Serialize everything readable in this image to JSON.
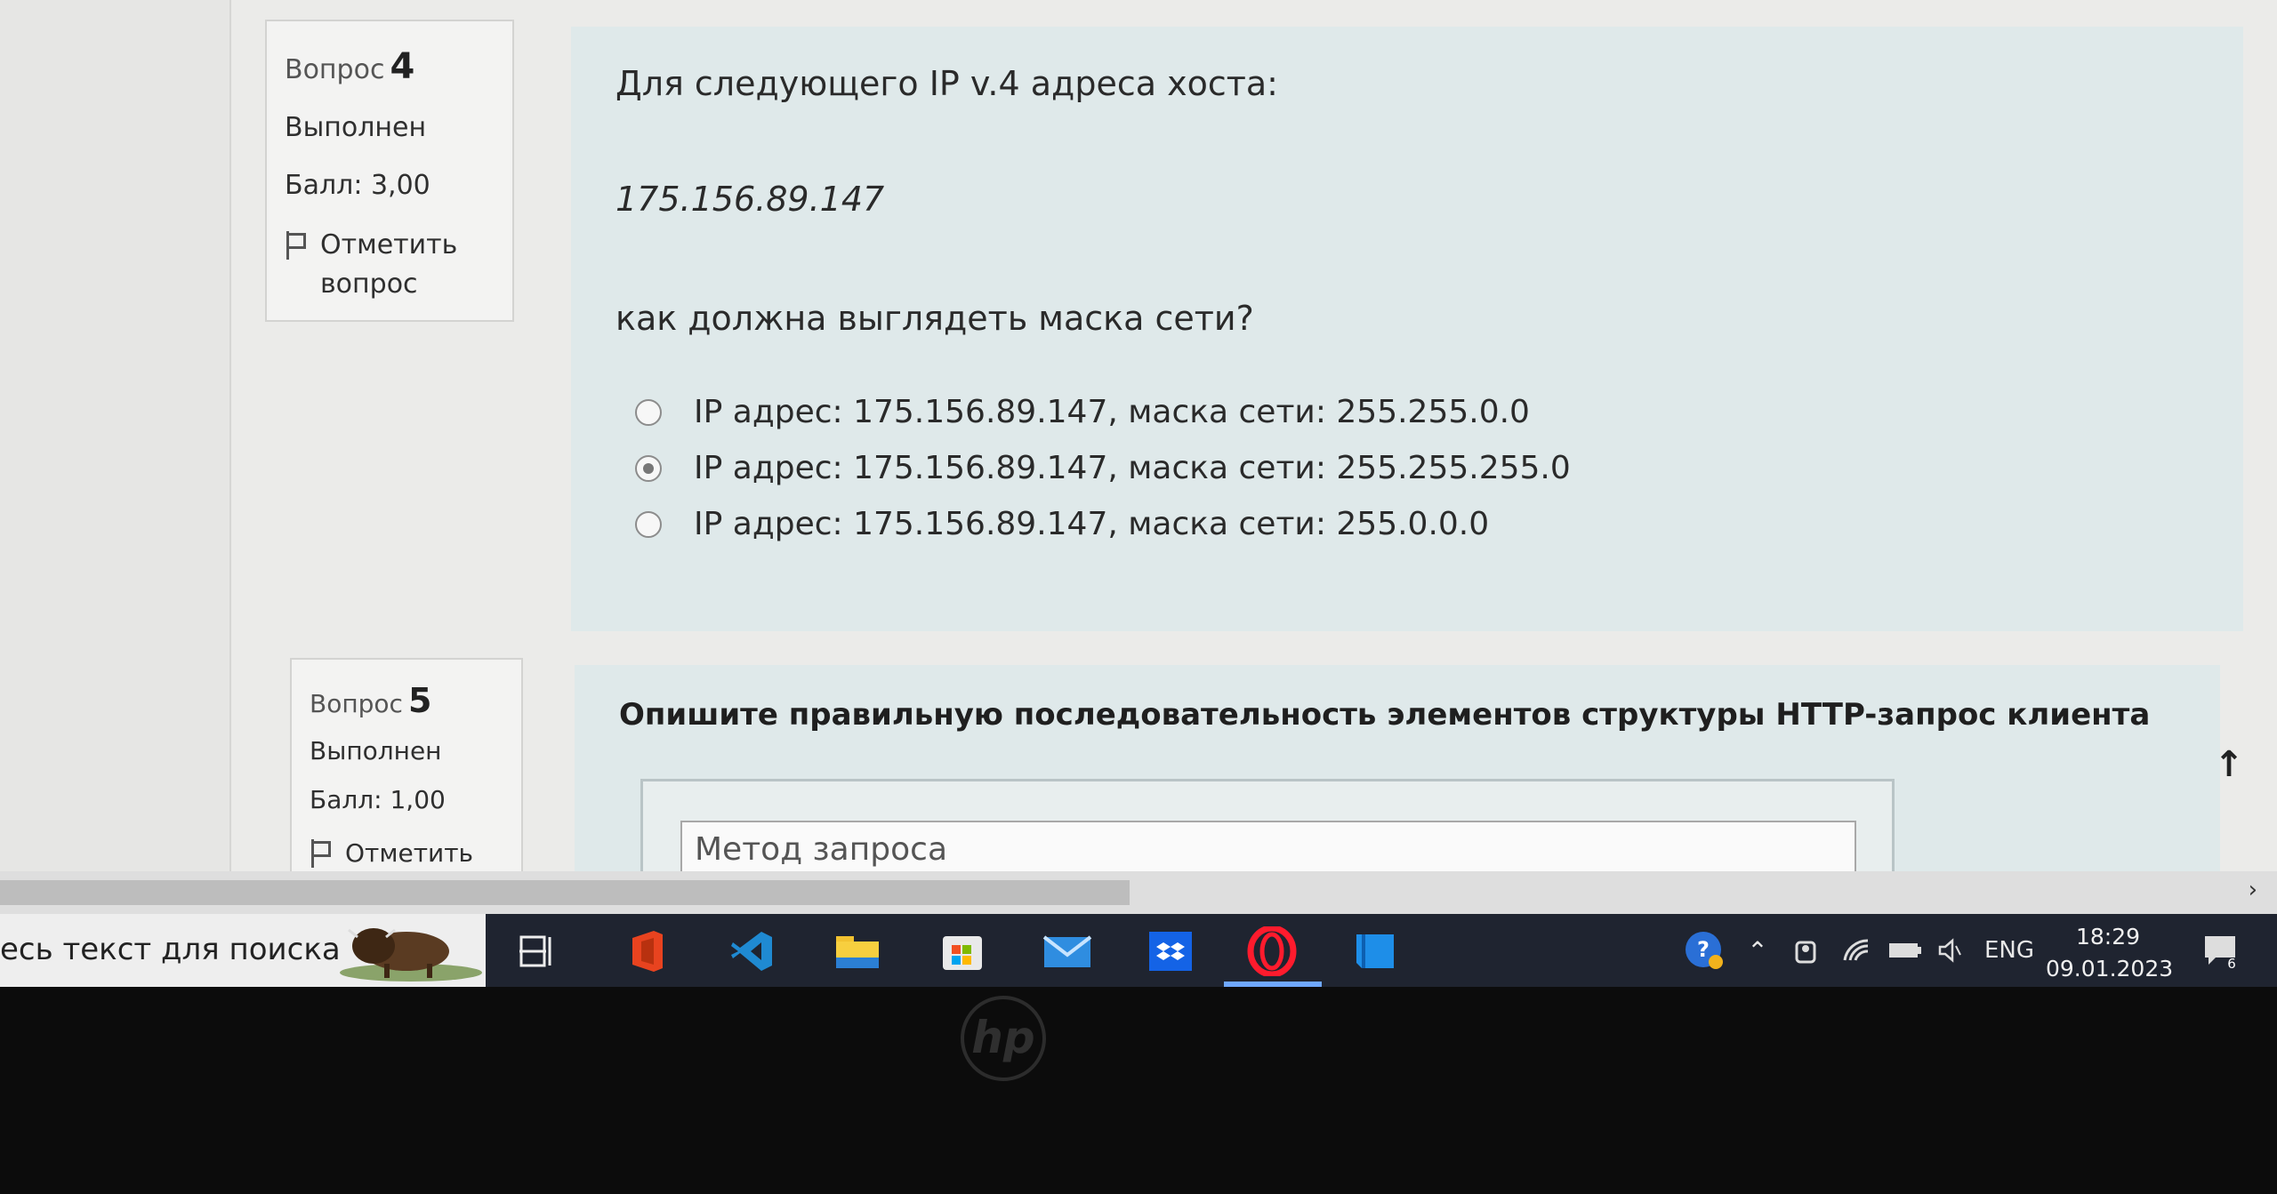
{
  "question4": {
    "label": "Вопрос",
    "number": "4",
    "state": "Выполнен",
    "grade": "Балл: 3,00",
    "flag_label_line1": "Отметить",
    "flag_label_line2": "вопрос",
    "text": "Для следующего IP v.4 адреса хоста:",
    "ip": "175.156.89.147",
    "ask": "как должна выглядеть маска сети?",
    "answers": [
      {
        "label": "IP адрес: 175.156.89.147, маска сети: 255.255.0.0",
        "checked": false
      },
      {
        "label": "IP адрес: 175.156.89.147, маска сети: 255.255.255.0",
        "checked": true
      },
      {
        "label": "IP адрес: 175.156.89.147, маска сети: 255.0.0.0",
        "checked": false
      }
    ]
  },
  "question5": {
    "label": "Вопрос",
    "number": "5",
    "state": "Выполнен",
    "grade": "Балл: 1,00",
    "flag_label": "Отметить",
    "title": "Опишите правильную последовательность элементов структуры HTTP-запрос клиента",
    "first_item": "Метод запроса"
  },
  "taskbar": {
    "search_text": "есь текст для поиска",
    "apps": [
      "task-view",
      "office",
      "vscode",
      "file-explorer",
      "microsoft-store",
      "mail",
      "dropbox",
      "opera",
      "book"
    ],
    "active_app": "opera",
    "lang": "ENG",
    "time": "18:29",
    "date": "09.01.2023",
    "notification_count": "6"
  },
  "colors": {
    "question_bg": "#dfe9ea",
    "page_bg": "#ebebe9",
    "taskbar_bg": "#1f2430",
    "accent": "#6fa8ff"
  }
}
